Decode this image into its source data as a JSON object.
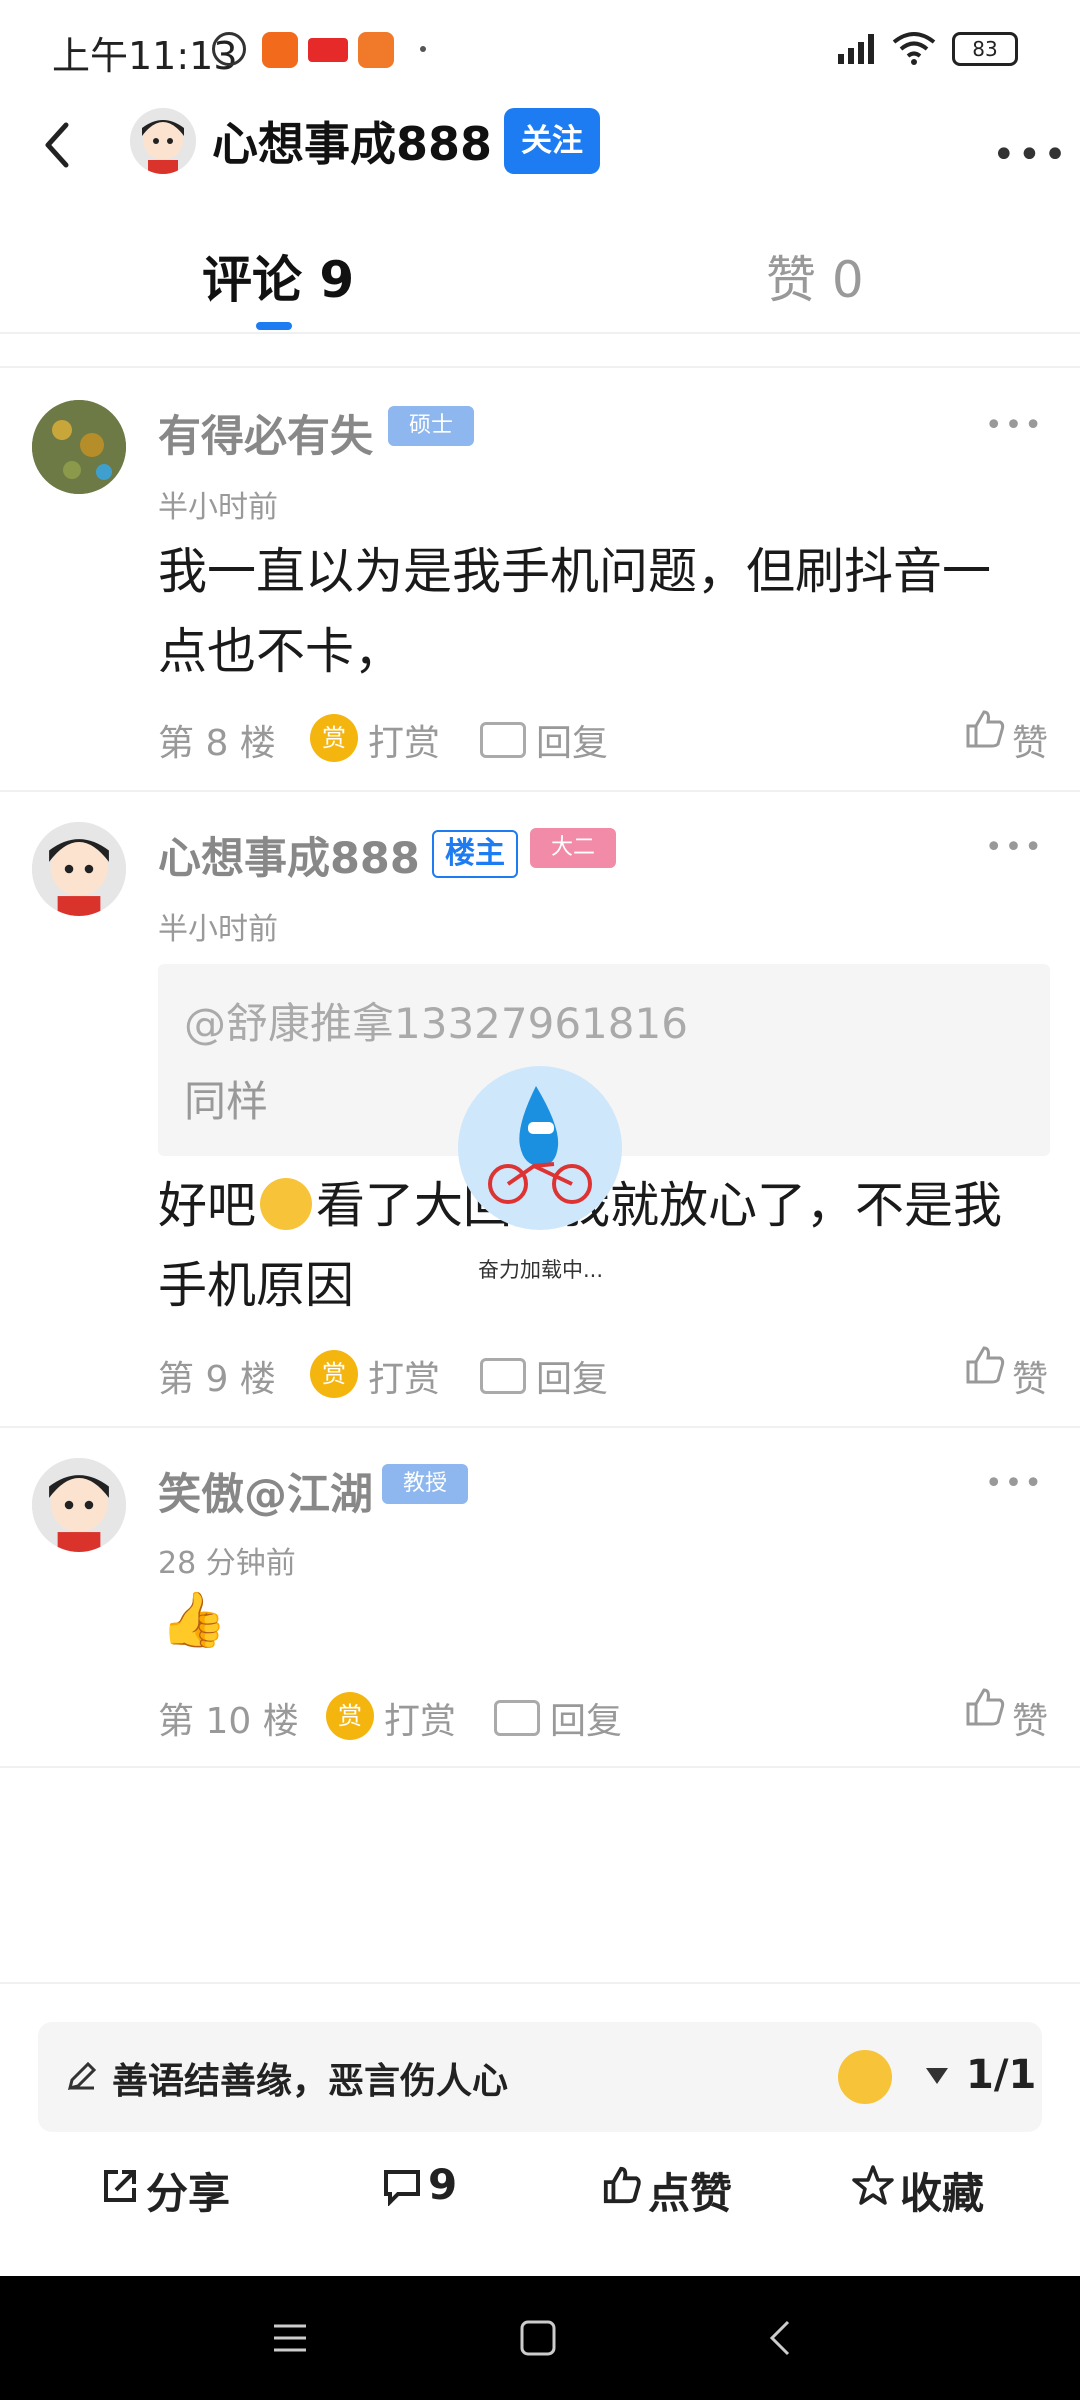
{
  "status_bar": {
    "time": "上午11:13",
    "battery": "83"
  },
  "header": {
    "title": "心想事成888",
    "follow_label": "关注"
  },
  "tabs": [
    {
      "label": "评论 9",
      "active": true
    },
    {
      "label": "赞 0",
      "active": false
    }
  ],
  "comments": [
    {
      "author": "有得必有失",
      "badge": "硕士",
      "time": "半小时前",
      "text": "我一直以为是我手机问题，但刷抖音一点也不卡，",
      "floor": "第 8 楼",
      "reward": "打赏",
      "reply": "回复",
      "like": "赞"
    },
    {
      "author": "心想事成888",
      "owner_badge": "楼主",
      "badge": "大二",
      "time": "半小时前",
      "quote_user": "@舒康推拿13327961816",
      "quote_text": "同样",
      "text_part1": "好吧",
      "text_part2": "看了大",
      "text_part3": "回复我就放心了，不是我手机原因",
      "floor": "第 9 楼",
      "reward": "打赏",
      "reply": "回复",
      "like": "赞"
    },
    {
      "author": "笑傲@江湖",
      "badge": "教授",
      "time": "28 分钟前",
      "emoji": "👍",
      "floor": "第 10 楼",
      "reward": "打赏",
      "reply": "回复",
      "like": "赞"
    }
  ],
  "reward_coin": "赏",
  "loading_text": "奋力加载中...",
  "composer": {
    "placeholder": "善语结善缘，恶言伤人心",
    "pager": "1/1"
  },
  "actions": {
    "share": "分享",
    "comments": "9",
    "like": "点赞",
    "favorite": "收藏"
  }
}
